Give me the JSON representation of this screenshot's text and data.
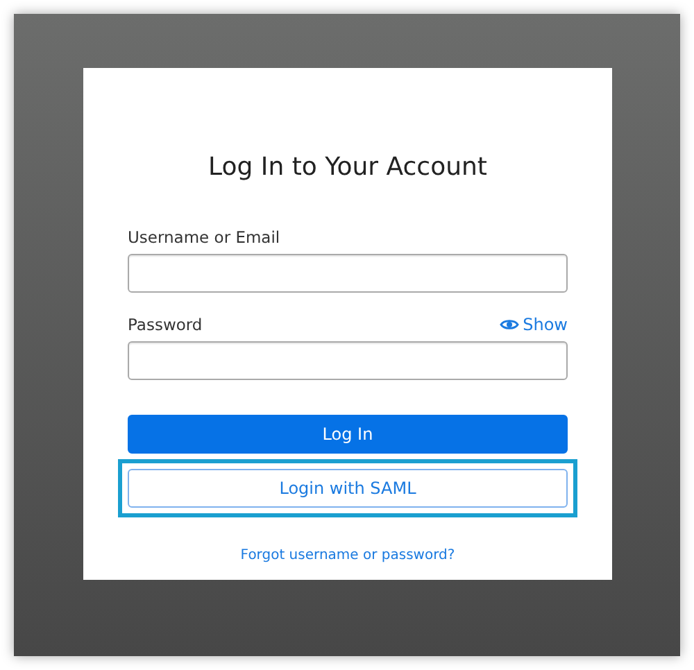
{
  "title": "Log In to Your Account",
  "fields": [
    {
      "label": "Username or Email"
    },
    {
      "label": "Password",
      "toggle": "Show"
    }
  ],
  "buttons": [
    {
      "label": "Log In",
      "kind": "primary",
      "highlighted": false
    },
    {
      "label": "Login with SAML",
      "kind": "outline",
      "highlighted": true
    }
  ],
  "link": "Forgot username or password?"
}
